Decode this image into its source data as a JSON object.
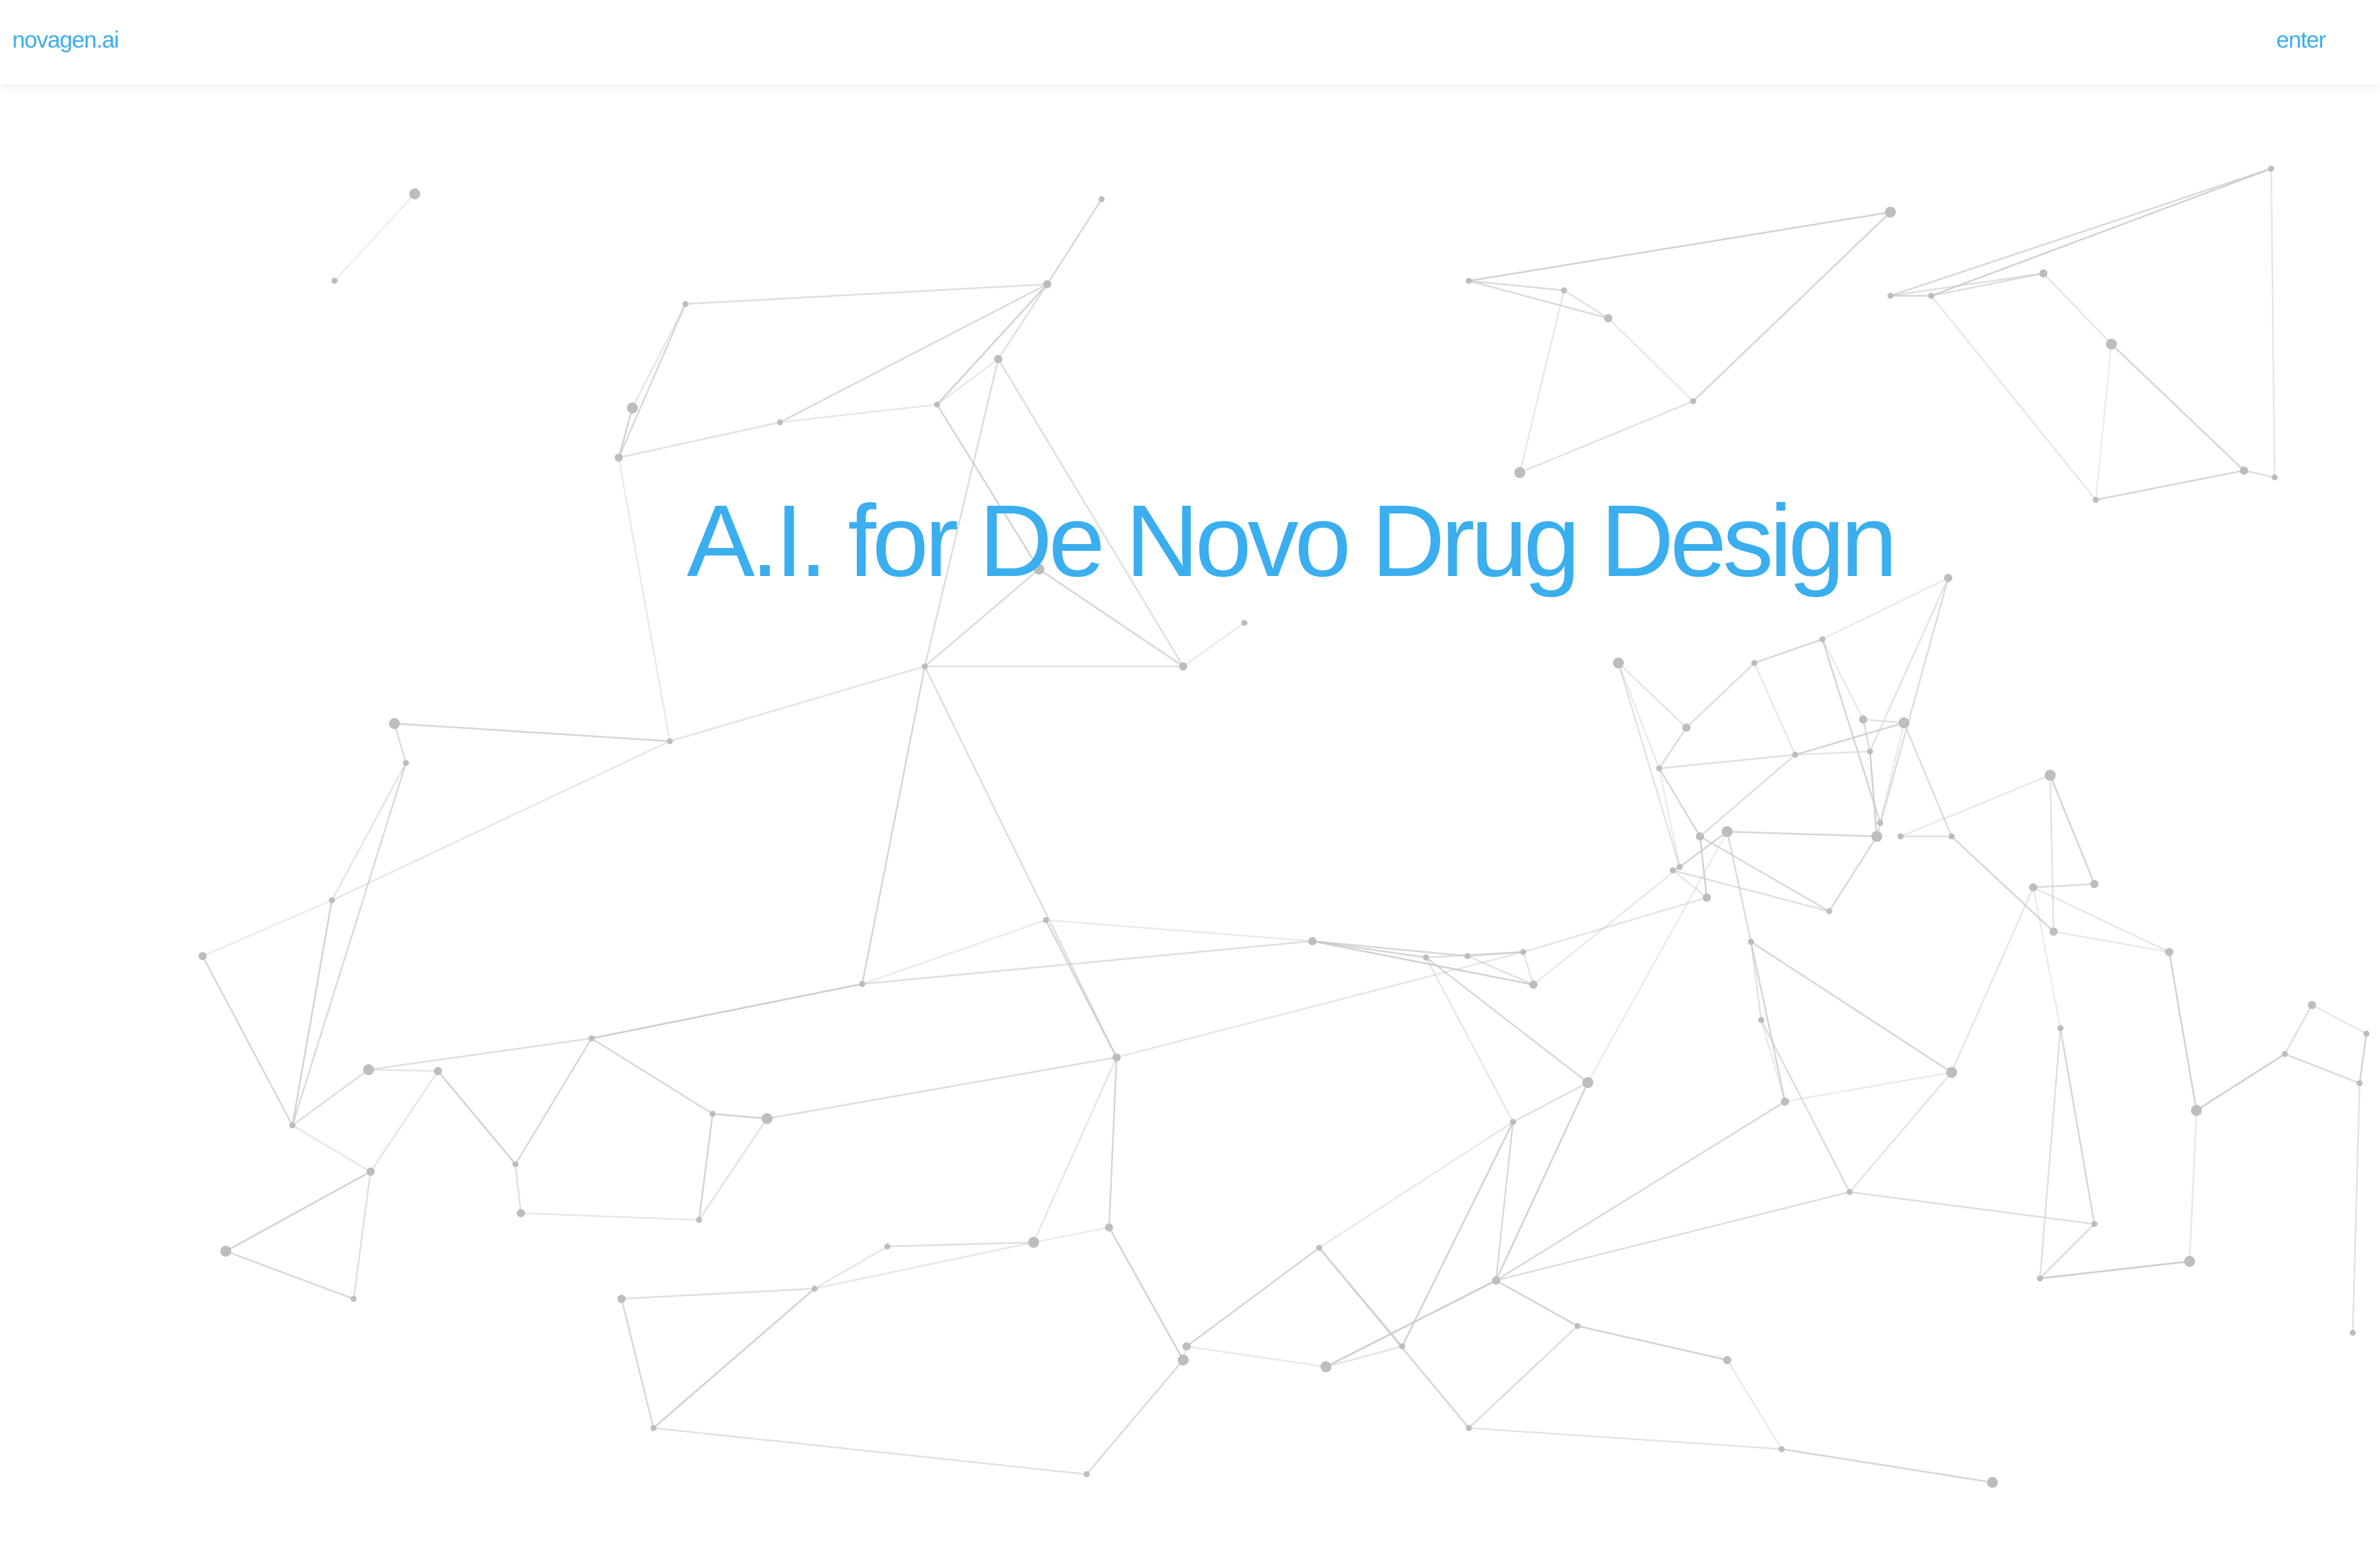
{
  "nav": {
    "brand": "novagen.ai",
    "enter_label": "enter"
  },
  "hero": {
    "headline": "A.I. for De Novo Drug Design"
  },
  "colors": {
    "accent": "#3aaeee",
    "edge": "#c8c8c8",
    "node": "#bdbdbd",
    "background": "#ffffff"
  },
  "background_graphic": {
    "description_icon": "molecular-network-graphic"
  }
}
